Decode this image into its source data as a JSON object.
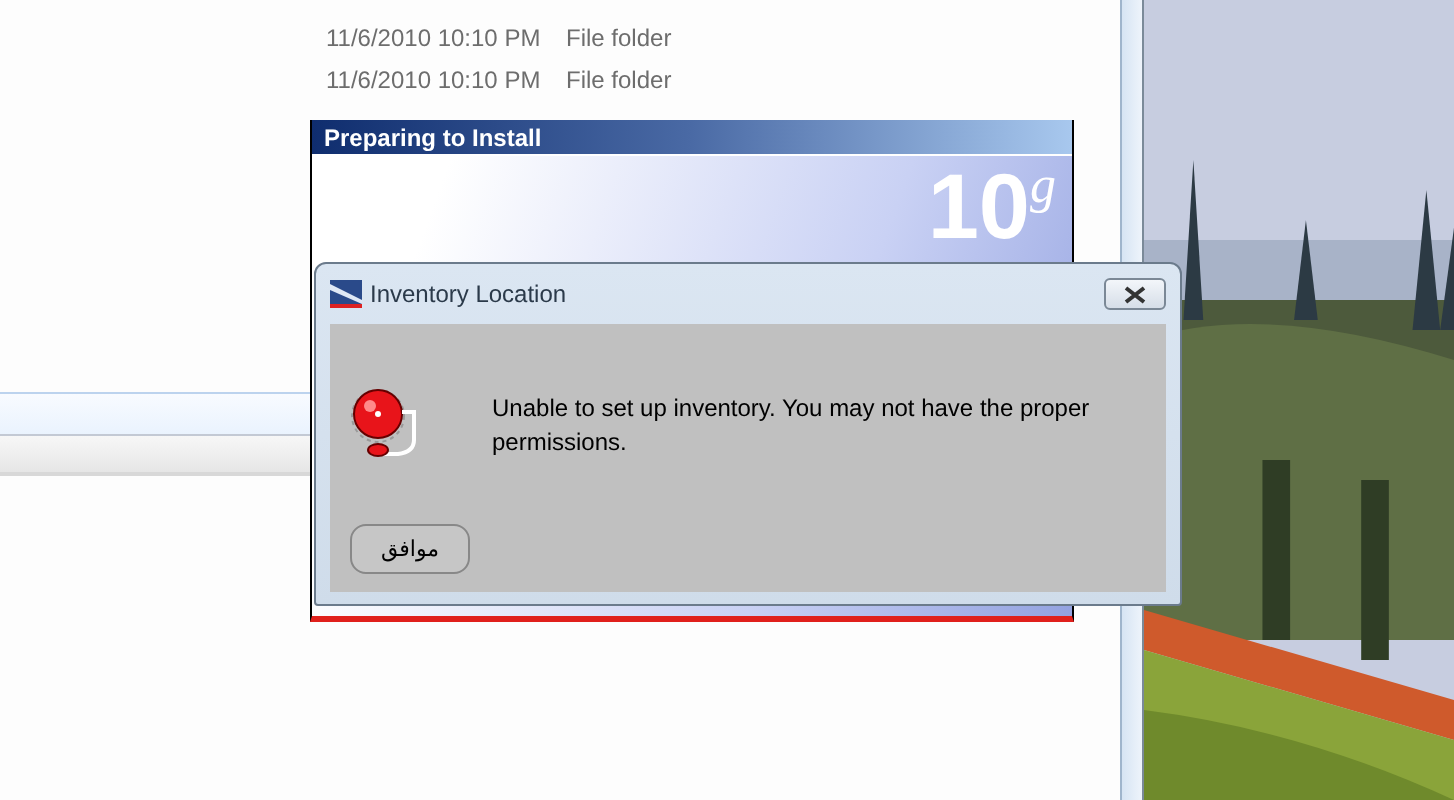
{
  "explorer": {
    "rows": [
      {
        "date": "11/6/2010 10:10 PM",
        "type": "File folder"
      },
      {
        "date": "11/6/2010 10:10 PM",
        "type": "File folder"
      }
    ]
  },
  "installer": {
    "title": "Preparing to Install",
    "logo_number": "10",
    "logo_letter": "g"
  },
  "dialog": {
    "title": "Inventory Location",
    "message": "Unable to set up inventory. You may not have the proper permissions.",
    "buttons": [
      {
        "label": "موافق"
      }
    ]
  }
}
